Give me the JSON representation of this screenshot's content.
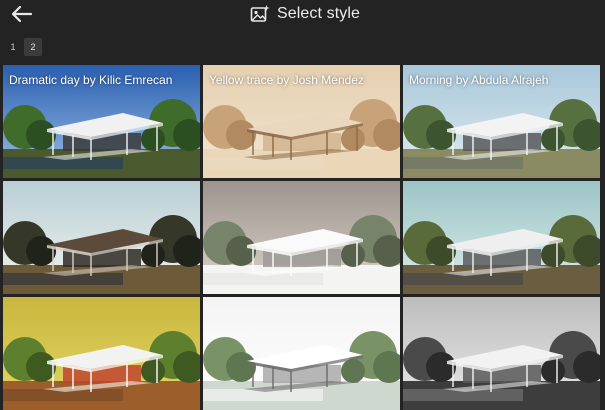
{
  "header": {
    "back_icon": "arrow-left-icon",
    "title_icon": "image-sparkle-icon",
    "title": "Select style"
  },
  "pagination": {
    "pages": [
      "1",
      "2"
    ],
    "current": "2"
  },
  "styles": [
    {
      "label": "Dramatic day by Kilic Emrecan",
      "theme": "dramatic-day",
      "selected": true
    },
    {
      "label": "Yellow trace by Josh Mendez",
      "theme": "yellow-trace"
    },
    {
      "label": "Morning by Abdula Alrajeh",
      "theme": "morning"
    },
    {
      "label": "",
      "theme": "dusk"
    },
    {
      "label": "",
      "theme": "white-model"
    },
    {
      "label": "",
      "theme": "teal"
    },
    {
      "label": "",
      "theme": "yellow-pop"
    },
    {
      "label": "",
      "theme": "white-sketch"
    },
    {
      "label": "",
      "theme": "monochrome"
    }
  ],
  "themes": {
    "dramatic-day": {
      "sky1": "#2a5fb0",
      "sky2": "#9dc1e6",
      "ground": "#4b5a2e",
      "tree": "#3f6b2b",
      "tree2": "#2c4f22",
      "roof": "#f1f1f1",
      "interior": "#3a3a3a",
      "line": "#f4f4f4",
      "water": "#2d4258"
    },
    "yellow-trace": {
      "sky1": "#e5cfb0",
      "sky2": "#f2e6d2",
      "ground": "#ead7b8",
      "tree": "#c8a37a",
      "tree2": "#b18a61",
      "roof": "#e9d8bd",
      "interior": "#d2b48f",
      "line": "#8a6745",
      "water": "#ead9bf"
    },
    "morning": {
      "sky1": "#a8c7da",
      "sky2": "#e1ecef",
      "ground": "#8a8a63",
      "tree": "#56713f",
      "tree2": "#3c5530",
      "roof": "#f3f3f3",
      "interior": "#58595a",
      "line": "#f6f6f6",
      "water": "#6f7764"
    },
    "dusk": {
      "sky1": "#b8cfd6",
      "sky2": "#f3f3ef",
      "ground": "#6d5a38",
      "tree": "#353828",
      "tree2": "#1f231a",
      "roof": "#5c4a3a",
      "interior": "#2f2a24",
      "line": "#d9d2c3",
      "water": "#3b3b3b"
    },
    "white-model": {
      "sky1": "#9d958d",
      "sky2": "#dcd5cc",
      "ground": "#f4f4f2",
      "tree": "#77836a",
      "tree2": "#57604b",
      "roof": "#fafafa",
      "interior": "#9c9994",
      "line": "#ffffff",
      "water": "#e7e7e3"
    },
    "teal": {
      "sky1": "#9dc5c6",
      "sky2": "#dbeceb",
      "ground": "#6b5d3f",
      "tree": "#596b3a",
      "tree2": "#3e4b2a",
      "roof": "#efefef",
      "interior": "#5b5b5b",
      "line": "#f3f3f3",
      "water": "#4c4c4a"
    },
    "yellow-pop": {
      "sky1": "#c9b63e",
      "sky2": "#e4d867",
      "ground": "#9c5e2a",
      "tree": "#5e7f2e",
      "tree2": "#3e5a20",
      "roof": "#f2f2f0",
      "interior": "#c0452e",
      "line": "#ffffff",
      "water": "#7e4c2a"
    },
    "white-sketch": {
      "sky1": "#f4f4f4",
      "sky2": "#ffffff",
      "ground": "#cfd8cf",
      "tree": "#7a9366",
      "tree2": "#5f7750",
      "roof": "#ffffff",
      "interior": "#a9a9a9",
      "line": "#6a6a6a",
      "water": "#eef0ee"
    },
    "monochrome": {
      "sky1": "#bdbdbd",
      "sky2": "#e9e9e9",
      "ground": "#3d3d3d",
      "tree": "#4a4a4a",
      "tree2": "#2b2b2b",
      "roof": "#f2f2f2",
      "interior": "#595959",
      "line": "#f5f5f5",
      "water": "#6a6a6a"
    }
  }
}
